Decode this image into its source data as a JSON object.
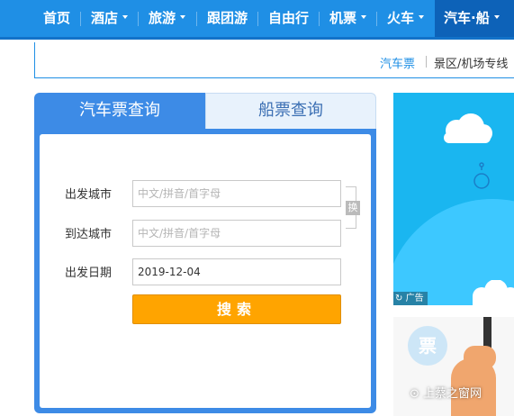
{
  "nav": {
    "items": [
      {
        "label": "首页"
      },
      {
        "label": "酒店"
      },
      {
        "label": "旅游"
      },
      {
        "label": "跟团游"
      },
      {
        "label": "自由行"
      },
      {
        "label": "机票"
      },
      {
        "label": "火车"
      },
      {
        "label": "汽车·船"
      }
    ]
  },
  "subnav": {
    "items": [
      {
        "label": "汽车票"
      },
      {
        "label": "景区/机场专线"
      }
    ]
  },
  "search": {
    "tabs": [
      {
        "label": "汽车票查询"
      },
      {
        "label": "船票查询"
      }
    ],
    "from_label": "出发城市",
    "from_placeholder": "中文/拼音/首字母",
    "to_label": "到达城市",
    "to_placeholder": "中文/拼音/首字母",
    "date_label": "出发日期",
    "date_value": "2019-12-04",
    "swap_label": "换",
    "submit_label": "搜索"
  },
  "ads": {
    "tag_label": "广告",
    "promo_glyph": "票"
  },
  "watermark": "上蔡之窗网",
  "colors": {
    "nav_bg": "#1f8fe5",
    "nav_active": "#0d62b8",
    "tab_active": "#3d8be6",
    "button": "#ffa400"
  }
}
